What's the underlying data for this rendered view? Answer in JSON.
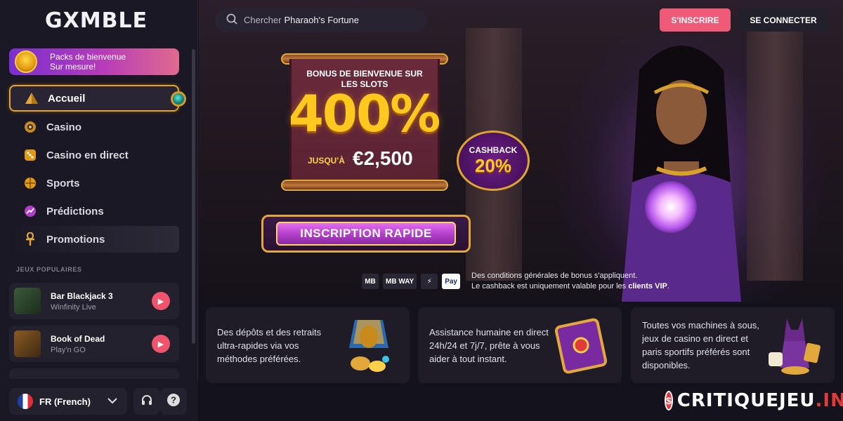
{
  "brand": {
    "logo": "GXMBLE"
  },
  "sidebar": {
    "welcome": {
      "line1": "Packs de bienvenue",
      "line2": "Sur mesure!"
    },
    "items": [
      {
        "label": "Accueil",
        "icon": "pyramid-icon"
      },
      {
        "label": "Casino",
        "icon": "casino-chip-icon"
      },
      {
        "label": "Casino en direct",
        "icon": "dice-icon"
      },
      {
        "label": "Sports",
        "icon": "ball-icon"
      },
      {
        "label": "Prédictions",
        "icon": "trend-icon"
      },
      {
        "label": "Promotions",
        "icon": "ankh-icon"
      }
    ],
    "popular_title": "JEUX POPULAIRES",
    "games": [
      {
        "name": "Bar Blackjack 3",
        "provider": "Winfinity Live"
      },
      {
        "name": "Book of Dead",
        "provider": "Play'n GO"
      }
    ],
    "language": "FR (French)"
  },
  "header": {
    "search_prefix": "Chercher",
    "search_value": "Pharaoh's Fortune",
    "register": "S'INSCRIRE",
    "login": "SE CONNECTER"
  },
  "hero": {
    "bonus_line1": "BONUS DE BIENVENUE SUR",
    "bonus_line2": "LES SLOTS",
    "bonus_pct": "400%",
    "upto": "JUSQU'À",
    "amount": "€2,500",
    "cashback_label": "CASHBACK",
    "cashback_pct": "20%",
    "cta": "INSCRIPTION RAPIDE",
    "payments": [
      "MB",
      "MB WAY",
      "⚡",
      " Pay"
    ],
    "terms_line1": "Des conditions générales de bonus s'appliquent.",
    "terms_line2_a": "Le cashback est uniquement valable pour les ",
    "terms_line2_b": "clients VIP",
    "terms_line2_c": "."
  },
  "features": [
    {
      "text": "Des dépôts et des retraits ultra-rapides via vos méthodes préférées."
    },
    {
      "text": "Assistance humaine en direct 24h/24 et 7j/7, prête à vous aider à tout instant."
    },
    {
      "text": "Toutes vos machines à sous, jeux de casino en direct et paris sportifs préférés sont disponibles."
    }
  ],
  "watermark": {
    "name": "CRITIQUEJEU",
    "ext": ".INFO",
    "badge": "$"
  },
  "colors": {
    "accent_pink": "#ef5a78",
    "gold": "#e8a524",
    "purple": "#b23dc8"
  }
}
